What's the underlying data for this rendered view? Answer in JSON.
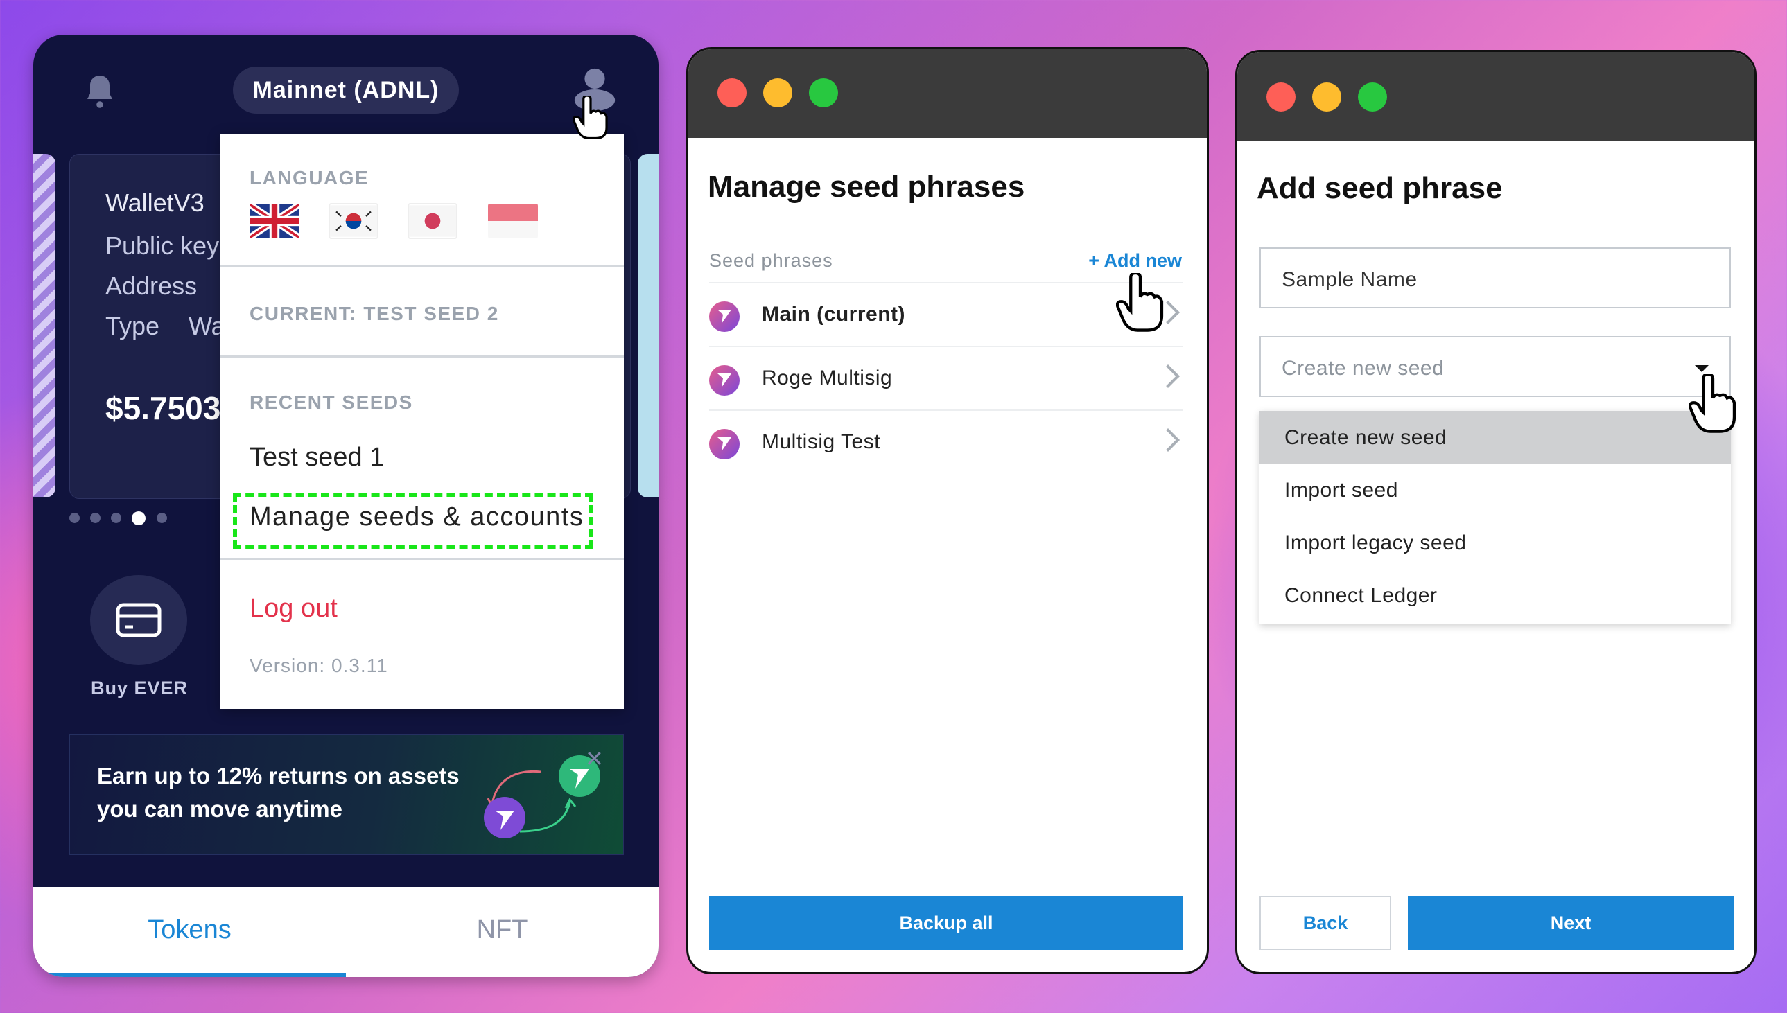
{
  "wallet": {
    "network": "Mainnet (ADNL)",
    "card": {
      "title": "WalletV3",
      "public_key_label": "Public key",
      "address_label": "Address",
      "type_label": "Type",
      "type_value": "Wa",
      "amount": "$5.7503"
    },
    "buy_label": "Buy EVER",
    "banner_text": "Earn up to 12% returns on assets you can move anytime",
    "tabs": [
      "Tokens",
      "NFT"
    ],
    "active_tab": "Tokens",
    "carousel": {
      "count": 5,
      "active_index": 3
    }
  },
  "account_menu": {
    "language_header": "LANGUAGE",
    "languages": [
      "english-flag-icon",
      "korean-flag-icon",
      "japanese-flag-icon",
      "indonesian-flag-icon"
    ],
    "current_label": "CURRENT: TEST SEED 2",
    "recent_header": "RECENT SEEDS",
    "recent_seeds": [
      "Test seed 1"
    ],
    "manage_label": "Manage seeds & accounts",
    "logout_label": "Log out",
    "version": "Version: 0.3.11"
  },
  "manage_window": {
    "title": "Manage seed phrases",
    "section_label": "Seed phrases",
    "add_new_label": "+ Add new",
    "seeds": [
      {
        "name": "Main (current)",
        "current": true
      },
      {
        "name": "Roge Multisig",
        "current": false
      },
      {
        "name": "Multisig Test",
        "current": false
      }
    ],
    "backup_label": "Backup all"
  },
  "add_window": {
    "title": "Add seed phrase",
    "name_value": "Sample Name",
    "select_value": "Create new seed",
    "options": [
      "Create new seed",
      "Import seed",
      "Import legacy seed",
      "Connect Ledger"
    ],
    "selected_option": "Create new seed",
    "back_label": "Back",
    "next_label": "Next"
  },
  "colors": {
    "accent": "#1a86d5",
    "logout": "#e3324b",
    "highlight": "#19e619",
    "panel_dark": "#10133d"
  }
}
